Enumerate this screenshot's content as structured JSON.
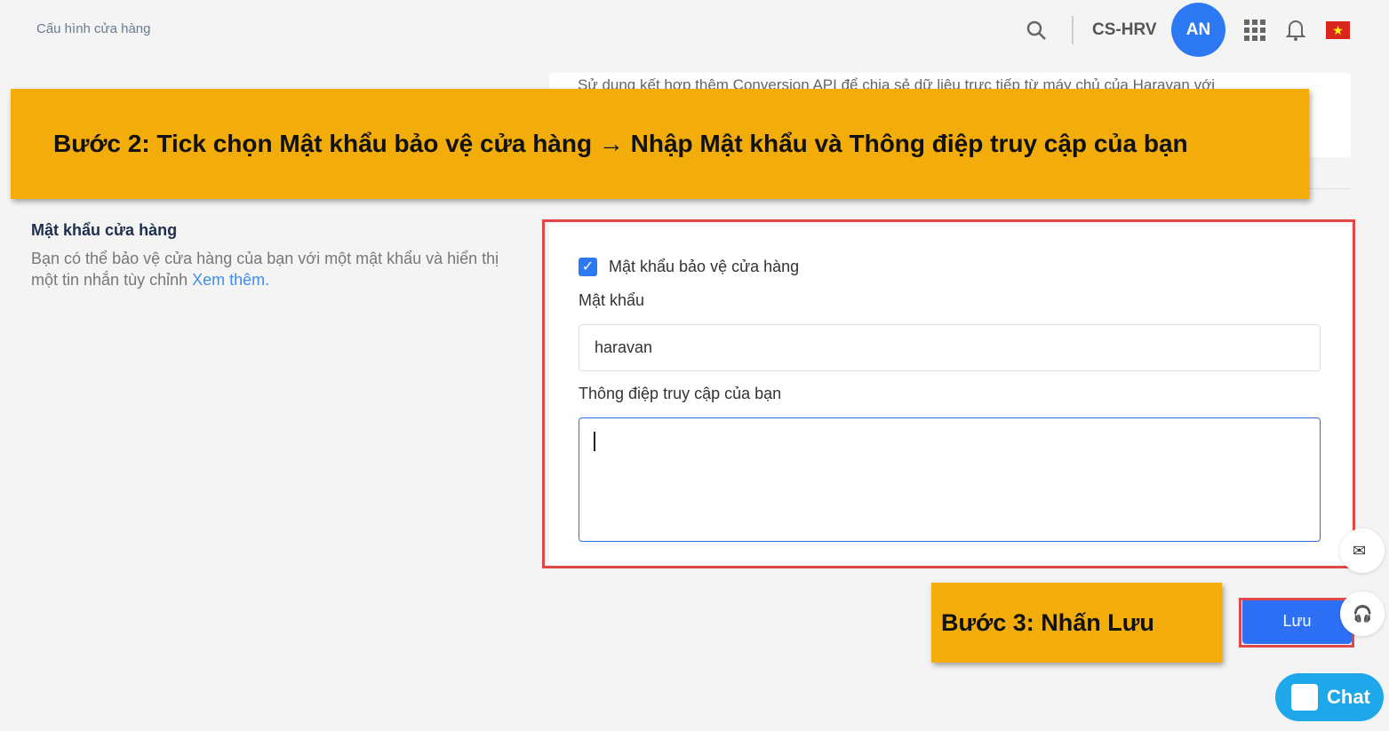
{
  "header": {
    "breadcrumb": "Cấu hình cửa hàng",
    "store": "CS-HRV",
    "avatar": "AN",
    "flag": "★"
  },
  "top_card": {
    "text": "Sử dụng kết hợp thêm Conversion API để chia sẻ dữ liệu trực tiếp từ máy chủ của Haravan với"
  },
  "annotations": {
    "step2": "Bước 2: Tick chọn Mật khẩu bảo vệ cửa hàng → Nhập Mật khẩu và Thông điệp truy cập của bạn",
    "step3": "Bước 3: Nhấn Lưu"
  },
  "section": {
    "title": "Mật khẩu cửa hàng",
    "desc": "Bạn có thể bảo vệ cửa hàng của bạn với một mật khẩu và hiển thị một tin nhắn tùy chỉnh ",
    "link": "Xem thêm."
  },
  "form": {
    "checkbox_label": "Mật khẩu bảo vệ cửa hàng",
    "checked": true,
    "password_label": "Mật khẩu",
    "password_value": "haravan",
    "message_label": "Thông điệp truy cập của bạn",
    "message_value": ""
  },
  "save_label": "Lưu",
  "chat_label": "Chat"
}
